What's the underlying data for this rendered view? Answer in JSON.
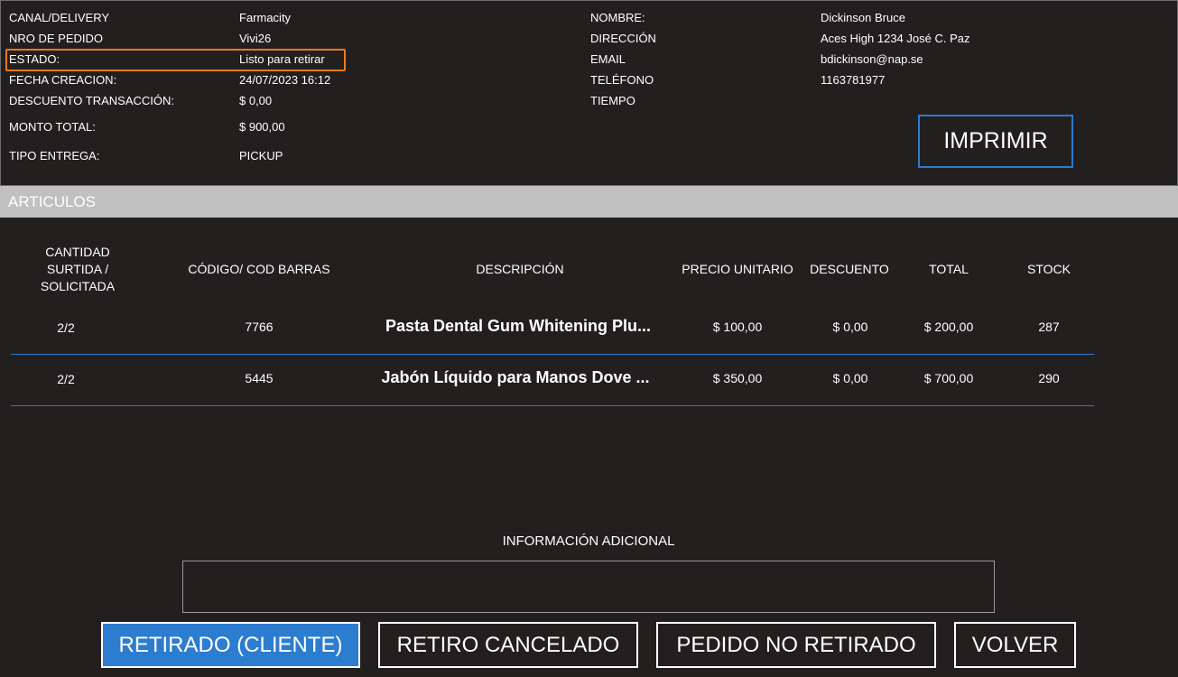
{
  "order_info": {
    "canal_label": "CANAL/DELIVERY",
    "canal_value": "Farmacity",
    "nro_label": "NRO DE PEDIDO",
    "nro_value": "Vivi26",
    "estado_label": "ESTADO:",
    "estado_value": "Listo para retirar",
    "fecha_label": "FECHA CREACION:",
    "fecha_value": "24/07/2023 16:12",
    "descuento_label": "DESCUENTO TRANSACCIÓN:",
    "descuento_value": "$ 0,00",
    "monto_label": "MONTO TOTAL:",
    "monto_value": "$ 900,00",
    "tipo_label": "TIPO ENTREGA:",
    "tipo_value": "PICKUP"
  },
  "customer_info": {
    "nombre_label": "NOMBRE:",
    "nombre_value": "Dickinson Bruce",
    "direccion_label": "DIRECCIÓN",
    "direccion_value": "Aces High 1234 José C. Paz",
    "email_label": "EMAIL",
    "email_value": "bdickinson@nap.se",
    "telefono_label": "TELÉFONO",
    "telefono_value": "1163781977",
    "tiempo_label": "TIEMPO"
  },
  "print_button": "IMPRIMIR",
  "section_title": "ARTICULOS",
  "table": {
    "headers": {
      "cantidad": [
        "CANTIDAD",
        "SURTIDA /",
        "SOLICITADA"
      ],
      "codigo": "CÓDIGO/ COD BARRAS",
      "descripcion": "DESCRIPCIÓN",
      "precio": "PRECIO UNITARIO",
      "descuento": "DESCUENTO",
      "total": "TOTAL",
      "stock": "STOCK"
    },
    "rows": [
      {
        "cantidad": "2/2",
        "codigo": "7766",
        "descripcion": "Pasta Dental Gum Whitening Plu...",
        "precio": "$ 100,00",
        "descuento": "$ 0,00",
        "total": "$ 200,00",
        "stock": "287"
      },
      {
        "cantidad": "2/2",
        "codigo": "5445",
        "descripcion": "Jabón Líquido para Manos Dove ...",
        "precio": "$ 350,00",
        "descuento": "$ 0,00",
        "total": "$ 700,00",
        "stock": "290"
      }
    ]
  },
  "additional_info": {
    "label": "INFORMACIÓN ADICIONAL",
    "value": ""
  },
  "actions": {
    "retirado": "RETIRADO (CLIENTE)",
    "cancelado": "RETIRO CANCELADO",
    "no_retirado": "PEDIDO NO RETIRADO",
    "volver": "VOLVER"
  },
  "colors": {
    "background": "#231f1f",
    "accent_blue": "#2c7cd0",
    "highlight_orange": "#f07a14",
    "section_bar": "#c0c0c0"
  }
}
